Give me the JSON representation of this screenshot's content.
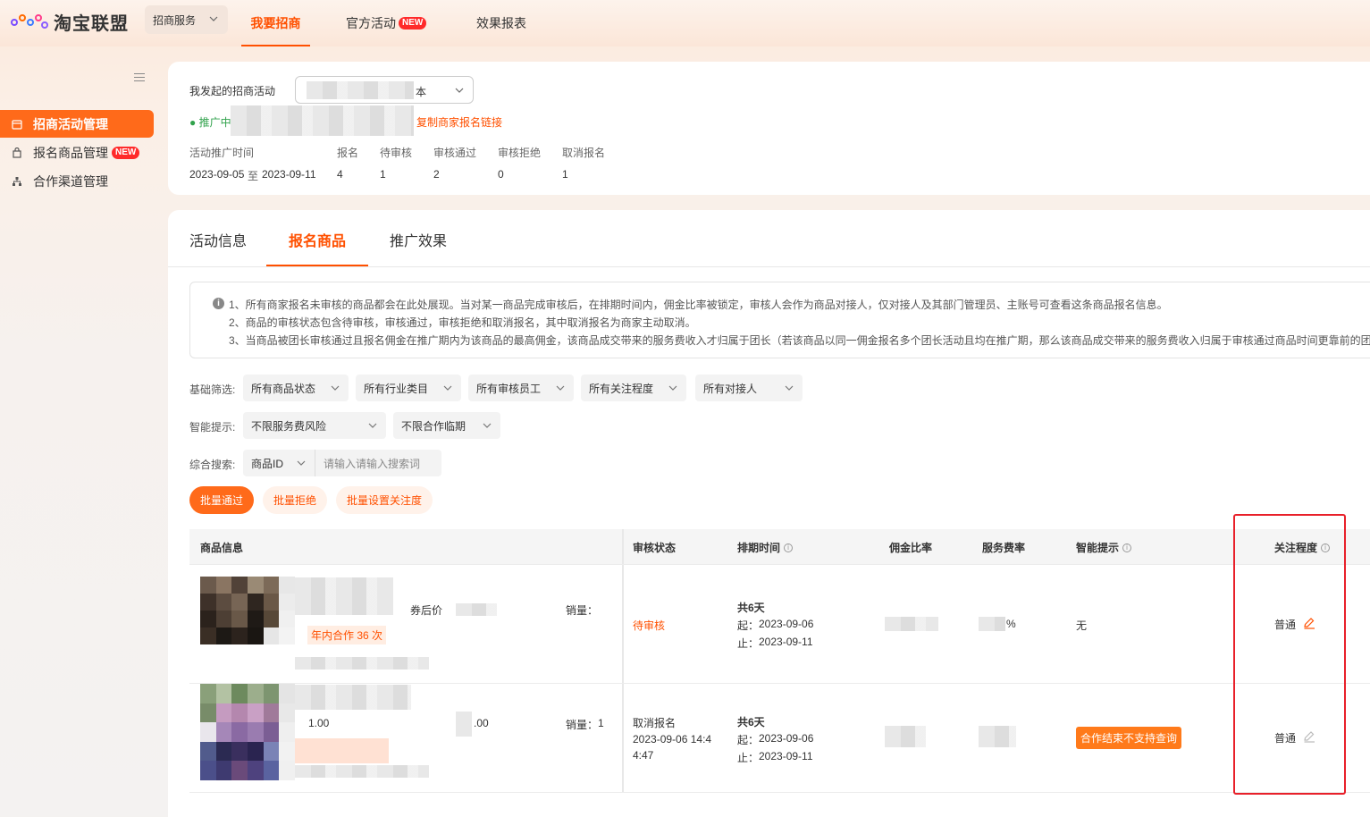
{
  "brand": {
    "name": "淘宝联盟"
  },
  "topnav": {
    "biz_select": "招商服务",
    "tabs": [
      {
        "label": "我要招商",
        "active": true
      },
      {
        "label": "官方活动",
        "badge": "NEW"
      },
      {
        "label": "效果报表"
      }
    ]
  },
  "sidebar": {
    "items": [
      {
        "label": "招商活动管理",
        "active": true
      },
      {
        "label": "报名商品管理",
        "badge": "NEW"
      },
      {
        "label": "合作渠道管理"
      }
    ]
  },
  "summary": {
    "my_activity_label": "我发起的招商活动",
    "activity_select_suffix": "本",
    "status": "● 推广中",
    "copy_link": "复制商家报名链接",
    "period_label": "活动推广时间",
    "period_start": "2023-09-05",
    "period_to": "至",
    "period_end": "2023-09-11",
    "stats": [
      {
        "label": "报名",
        "value": "4"
      },
      {
        "label": "待审核",
        "value": "1"
      },
      {
        "label": "审核通过",
        "value": "2"
      },
      {
        "label": "审核拒绝",
        "value": "0"
      },
      {
        "label": "取消报名",
        "value": "1"
      }
    ]
  },
  "tabs": [
    {
      "label": "活动信息"
    },
    {
      "label": "报名商品",
      "active": true
    },
    {
      "label": "推广效果"
    }
  ],
  "notice": [
    "1、所有商家报名未审核的商品都会在此处展现。当对某一商品完成审核后，在排期时间内，佣金比率被锁定，审核人会作为商品对接人，仅对接人及其部门管理员、主账号可查看这条商品报名信息。",
    "2、商品的审核状态包含待审核，审核通过，审核拒绝和取消报名，其中取消报名为商家主动取消。",
    "3、当商品被团长审核通过且报名佣金在推广期内为该商品的最高佣金，该商品成交带来的服务费收入才归属于团长（若该商品以同一佣金报名多个团长活动且均在推广期，那么该商品成交带来的服务费收入归属于审核通过商品时间更靠前的团"
  ],
  "filters": {
    "basic_label": "基础筛选:",
    "basic": [
      "所有商品状态",
      "所有行业类目",
      "所有审核员工",
      "所有关注程度",
      "所有对接人"
    ],
    "smart_label": "智能提示:",
    "smart": [
      "不限服务费风险",
      "不限合作临期"
    ],
    "search_label": "综合搜索:",
    "search_field": "商品ID",
    "search_placeholder": "请输入请输入搜索词"
  },
  "actions": {
    "approve": "批量通过",
    "reject": "批量拒绝",
    "set_attention": "批量设置关注度"
  },
  "table": {
    "headers": {
      "product": "商品信息",
      "status": "审核状态",
      "schedule": "排期时间",
      "commission": "佣金比率",
      "service_fee": "服务费率",
      "smart_hint": "智能提示",
      "attention": "关注程度"
    },
    "rows": [
      {
        "coupon_label": "券后价",
        "sales_label": "销量：",
        "sales_value": "",
        "tag": "年内合作 36 次",
        "status": "待审核",
        "status_time": "",
        "days": "共6天",
        "start_label": "起：",
        "start": "2023-09-06",
        "end_label": "止：",
        "end": "2023-09-11",
        "service_suffix": "%",
        "hint": "无",
        "attention": "普通"
      },
      {
        "price_fragment": "1.00",
        "price_fragment2": ".00",
        "sales_label": "销量：",
        "sales_value": "1",
        "status": "取消报名",
        "status_time_1": "2023-09-06 14:4",
        "status_time_2": "4:47",
        "days": "共6天",
        "start_label": "起：",
        "start": "2023-09-06",
        "end_label": "止：",
        "end": "2023-09-11",
        "hint": "合作结束不支持查询",
        "attention": "普通"
      }
    ]
  },
  "colors": {
    "accent": "#ff5000",
    "accent_btn": "#ff6a1a",
    "highlight_box": "#e8202a"
  }
}
